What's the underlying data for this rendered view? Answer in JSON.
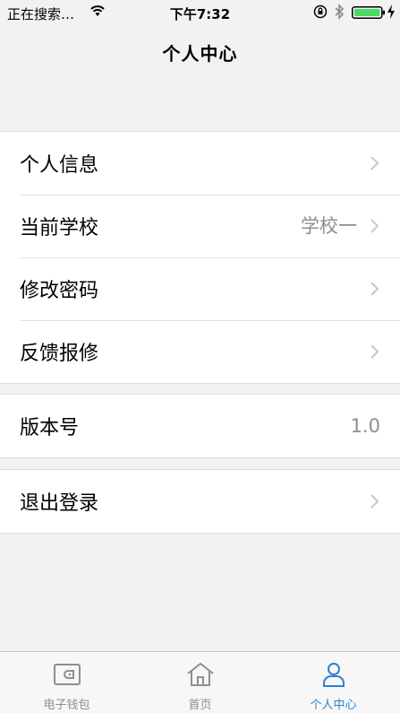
{
  "status_bar": {
    "carrier": "正在搜索…",
    "time": "下午7:32",
    "icons": [
      "wifi-icon",
      "rotation-lock-icon",
      "bluetooth-icon",
      "battery-icon",
      "charging-icon"
    ]
  },
  "nav": {
    "title": "个人中心"
  },
  "groups": [
    {
      "rows": [
        {
          "label": "个人信息",
          "value": ""
        },
        {
          "label": "当前学校",
          "value": "学校一"
        },
        {
          "label": "修改密码",
          "value": ""
        },
        {
          "label": "反馈报修",
          "value": ""
        }
      ]
    },
    {
      "rows": [
        {
          "label": "版本号",
          "value": "1.0"
        }
      ]
    },
    {
      "rows": [
        {
          "label": "退出登录",
          "value": ""
        }
      ]
    }
  ],
  "tab_bar": {
    "tabs": [
      {
        "label": "电子钱包",
        "icon": "wallet-icon",
        "active": false
      },
      {
        "label": "首页",
        "icon": "home-icon",
        "active": false
      },
      {
        "label": "个人中心",
        "icon": "person-icon",
        "active": true
      }
    ]
  },
  "colors": {
    "accent": "#2f80d1",
    "background": "#f2f2f2",
    "secondary_text": "#8e8e93"
  }
}
